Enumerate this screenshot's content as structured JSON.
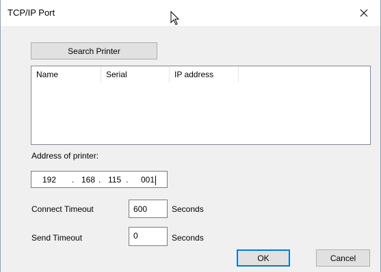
{
  "window": {
    "title": "TCP/IP Port"
  },
  "search_button": {
    "label": "Search Printer"
  },
  "printer_list": {
    "columns": [
      "Name",
      "Serial",
      "IP address"
    ],
    "rows": []
  },
  "address": {
    "label": "Address of printer:",
    "octets": [
      "192",
      "168",
      "115",
      "001"
    ],
    "separator": "."
  },
  "connect_timeout": {
    "label": "Connect Timeout",
    "value": "600",
    "unit": "Seconds"
  },
  "send_timeout": {
    "label": "Send Timeout",
    "value": "0",
    "unit": "Seconds"
  },
  "buttons": {
    "ok": "OK",
    "cancel": "Cancel"
  },
  "colors": {
    "accent": "#0078d7",
    "dialog_bg": "#f0f0f0",
    "button_bg": "#e1e1e1"
  }
}
